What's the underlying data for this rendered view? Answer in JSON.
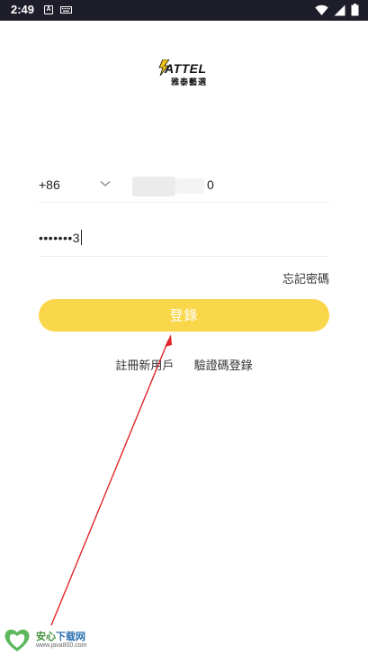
{
  "status_bar": {
    "time": "2:49",
    "icons": [
      "notification-a-icon",
      "keyboard-icon",
      "wifi-icon",
      "signal-icon",
      "battery-icon"
    ]
  },
  "logo": {
    "brand": "ATTEL",
    "subtitle": "雅泰藝選"
  },
  "phone": {
    "country_code": "+86",
    "value": "0"
  },
  "password": {
    "value": "•••••••3"
  },
  "forgot_label": "忘記密碼",
  "login_label": "登錄",
  "links": {
    "register": "註冊新用戶",
    "code_login": "驗證碼登錄"
  },
  "watermark": {
    "title_green": "安心",
    "title_blue": "下载网",
    "url": "www.java800.com"
  },
  "colors": {
    "accent": "#f9d64a",
    "status_bar": "#1e1e2a",
    "annotation_arrow": "#e0262a"
  }
}
